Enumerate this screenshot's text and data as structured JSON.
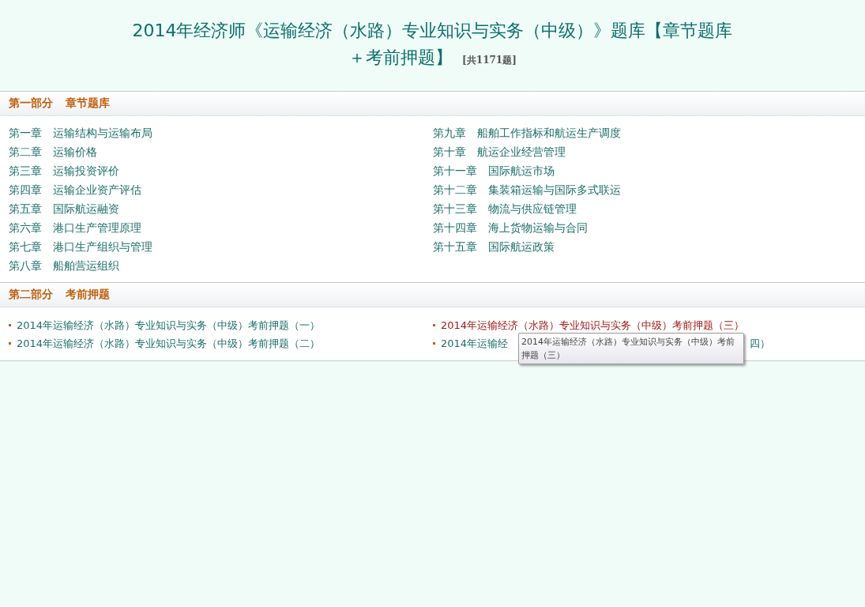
{
  "title": {
    "lines": [
      "2014年经济师《运输经济（水路）专业知识与实务（中级）》题库【章节题库",
      "＋考前押题】"
    ],
    "count": "[共1171题]"
  },
  "sections": [
    {
      "kind": "chapters",
      "number": "第一部分",
      "name": "章节题库",
      "items": [
        {
          "number": "第一章",
          "title": "运输结构与运输布局"
        },
        {
          "number": "第二章",
          "title": "运输价格"
        },
        {
          "number": "第三章",
          "title": "运输投资评价"
        },
        {
          "number": "第四章",
          "title": "运输企业资产评估"
        },
        {
          "number": "第五章",
          "title": "国际航运融资"
        },
        {
          "number": "第六章",
          "title": "港口生产管理原理"
        },
        {
          "number": "第七章",
          "title": "港口生产组织与管理"
        },
        {
          "number": "第八章",
          "title": "船舶营运组织"
        },
        {
          "number": "第九章",
          "title": "船舶工作指标和航运生产调度"
        },
        {
          "number": "第十章",
          "title": "航运企业经营管理"
        },
        {
          "number": "第十一章",
          "title": "国际航运市场"
        },
        {
          "number": "第十二章",
          "title": "集装箱运输与国际多式联运"
        },
        {
          "number": "第十三章",
          "title": "物流与供应链管理"
        },
        {
          "number": "第十四章",
          "title": "海上货物运输与合同"
        },
        {
          "number": "第十五章",
          "title": "国际航运政策"
        }
      ]
    },
    {
      "kind": "links",
      "number": "第二部分",
      "name": "考前押题",
      "items": [
        {
          "text": "2014年运输经济（水路）专业知识与实务（中级）考前押题（一）",
          "hovered": false
        },
        {
          "text": "2014年运输经济（水路）专业知识与实务（中级）考前押题（二）",
          "hovered": false
        },
        {
          "text": "2014年运输经济（水路）专业知识与实务（中级）考前押题（三）",
          "hovered": true
        },
        {
          "text": "2014年运输经",
          "text_end": "四）",
          "hovered": false
        }
      ]
    }
  ],
  "tooltip": {
    "text": "2014年运输经济（水路）专业知识与实务（中级）考前押题（三）"
  }
}
